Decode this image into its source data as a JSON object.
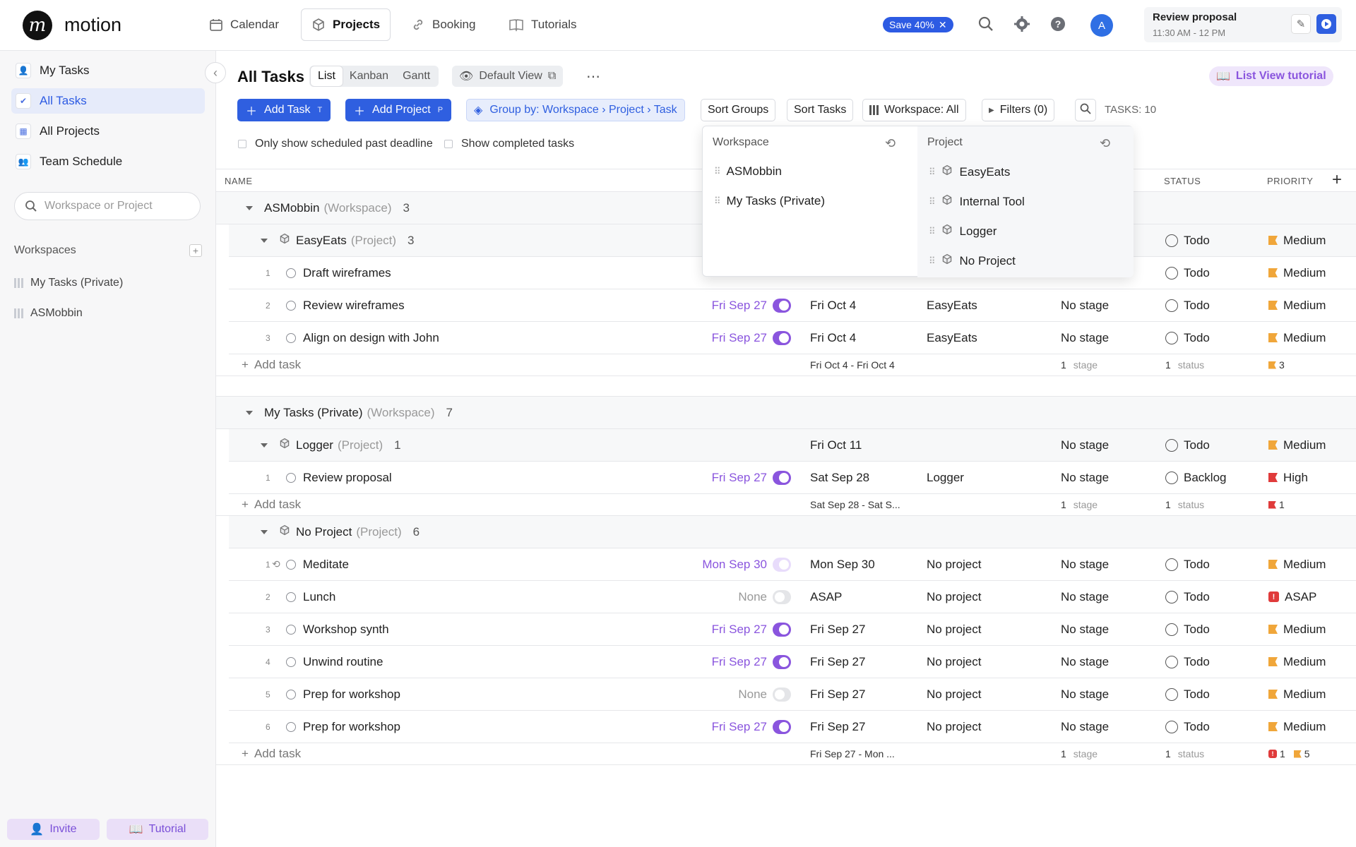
{
  "app": {
    "name": "motion"
  },
  "nav": {
    "tabs": [
      {
        "label": "Calendar",
        "icon": "calendar-icon"
      },
      {
        "label": "Projects",
        "icon": "box-icon"
      },
      {
        "label": "Booking",
        "icon": "link-icon"
      },
      {
        "label": "Tutorials",
        "icon": "book-icon"
      }
    ],
    "save_badge": "Save 40%",
    "avatar_initial": "A",
    "current_event": {
      "title": "Review proposal",
      "time": "11:30 AM - 12 PM"
    }
  },
  "sidebar": {
    "items": [
      {
        "label": "My Tasks"
      },
      {
        "label": "All Tasks"
      },
      {
        "label": "All Projects"
      },
      {
        "label": "Team Schedule"
      }
    ],
    "search_placeholder": "Workspace or Project",
    "workspaces_label": "Workspaces",
    "workspaces": [
      "My Tasks (Private)",
      "ASMobbin"
    ],
    "invite_label": "Invite",
    "tutorial_label": "Tutorial"
  },
  "main": {
    "title": "All Tasks",
    "views": [
      "List",
      "Kanban",
      "Gantt"
    ],
    "active_view": "List",
    "default_view_label": "Default View",
    "tutorial_label": "List View tutorial",
    "add_task_label": "Add Task",
    "add_task_key": "T",
    "add_project_label": "Add Project",
    "add_project_key": "P",
    "group_by_label": "Group by: Workspace › Project › Task",
    "sort_groups_label": "Sort Groups",
    "sort_tasks_label": "Sort Tasks",
    "workspace_filter_label": "Workspace: All",
    "filters_label": "Filters (0)",
    "task_count_label": "TASKS: 10",
    "only_past_deadline_label": "Only show scheduled past deadline",
    "show_completed_label": "Show completed tasks",
    "columns": {
      "name": "NAME",
      "status": "STATUS",
      "priority": "PRIORITY"
    },
    "add_task_row_label": "Add task"
  },
  "dropdown": {
    "workspace_header": "Workspace",
    "workspaces": [
      "ASMobbin",
      "My Tasks (Private)"
    ],
    "project_header": "Project",
    "projects": [
      "EasyEats",
      "Internal Tool",
      "Logger",
      "No Project"
    ]
  },
  "groups": [
    {
      "workspace": "ASMobbin",
      "workspace_suffix": "(Workspace)",
      "count": "3",
      "projects": [
        {
          "name": "EasyEats",
          "suffix": "(Project)",
          "count": "3",
          "head_status": "Todo",
          "head_priority": "Medium",
          "tasks": [
            {
              "num": "1",
              "name": "Draft wireframes",
              "status": "Todo",
              "priority": "Medium",
              "priority_kind": "med"
            },
            {
              "num": "2",
              "name": "Review wireframes",
              "scheduled": "Fri Sep 27",
              "deadline": "Fri Oct 4",
              "project": "EasyEats",
              "stage": "No stage",
              "status": "Todo",
              "priority": "Medium",
              "priority_kind": "med"
            },
            {
              "num": "3",
              "name": "Align on design with John",
              "scheduled": "Fri Sep 27",
              "deadline": "Fri Oct 4",
              "project": "EasyEats",
              "stage": "No stage",
              "status": "Todo",
              "priority": "Medium",
              "priority_kind": "med"
            }
          ],
          "footer": {
            "range": "Fri Oct 4 - Fri Oct 4",
            "stage_count": "1",
            "stage_label": "stage",
            "status_count": "1",
            "status_label": "status",
            "flag_count": "3"
          }
        }
      ]
    },
    {
      "workspace": "My Tasks (Private)",
      "workspace_suffix": "(Workspace)",
      "count": "7",
      "projects": [
        {
          "name": "Logger",
          "suffix": "(Project)",
          "count": "1",
          "head_deadline": "Fri Oct 11",
          "head_stage": "No stage",
          "head_status": "Todo",
          "head_priority": "Medium",
          "tasks": [
            {
              "num": "1",
              "name": "Review proposal",
              "scheduled": "Fri Sep 27",
              "deadline": "Sat Sep 28",
              "project": "Logger",
              "stage": "No stage",
              "status": "Backlog",
              "priority": "High",
              "priority_kind": "high"
            }
          ],
          "footer": {
            "range": "Sat Sep 28 - Sat S...",
            "stage_count": "1",
            "stage_label": "stage",
            "status_count": "1",
            "status_label": "status",
            "flag_count": "1"
          }
        },
        {
          "name": "No Project",
          "suffix": "(Project)",
          "count": "6",
          "tasks": [
            {
              "num": "1",
              "name": "Meditate",
              "scheduled": "Mon Sep 30",
              "deadline": "Mon Sep 30",
              "project": "No project",
              "stage": "No stage",
              "status": "Todo",
              "priority": "Medium",
              "priority_kind": "med"
            },
            {
              "num": "2",
              "name": "Lunch",
              "scheduled": "None",
              "deadline": "ASAP",
              "project": "No project",
              "stage": "No stage",
              "status": "Todo",
              "priority": "ASAP",
              "priority_kind": "asap"
            },
            {
              "num": "3",
              "name": "Workshop synth",
              "scheduled": "Fri Sep 27",
              "deadline": "Fri Sep 27",
              "project": "No project",
              "stage": "No stage",
              "status": "Todo",
              "priority": "Medium",
              "priority_kind": "med"
            },
            {
              "num": "4",
              "name": "Unwind routine",
              "scheduled": "Fri Sep 27",
              "deadline": "Fri Sep 27",
              "project": "No project",
              "stage": "No stage",
              "status": "Todo",
              "priority": "Medium",
              "priority_kind": "med"
            },
            {
              "num": "5",
              "name": "Prep for workshop",
              "scheduled": "None",
              "deadline": "Fri Sep 27",
              "project": "No project",
              "stage": "No stage",
              "status": "Todo",
              "priority": "Medium",
              "priority_kind": "med"
            },
            {
              "num": "6",
              "name": "Prep for workshop",
              "scheduled": "Fri Sep 27",
              "deadline": "Fri Sep 27",
              "project": "No project",
              "stage": "No stage",
              "status": "Todo",
              "priority": "Medium",
              "priority_kind": "med"
            }
          ],
          "footer": {
            "range": "Fri Sep 27 - Mon ...",
            "stage_count": "1",
            "stage_label": "stage",
            "status_count": "1",
            "status_label": "status",
            "asap_count": "1",
            "flag_count": "5"
          }
        }
      ]
    }
  ],
  "colors": {
    "accent": "#2f5fe0",
    "purple": "#8a55de",
    "medium_flag": "#f0a63a",
    "high_flag": "#e03b3b"
  }
}
